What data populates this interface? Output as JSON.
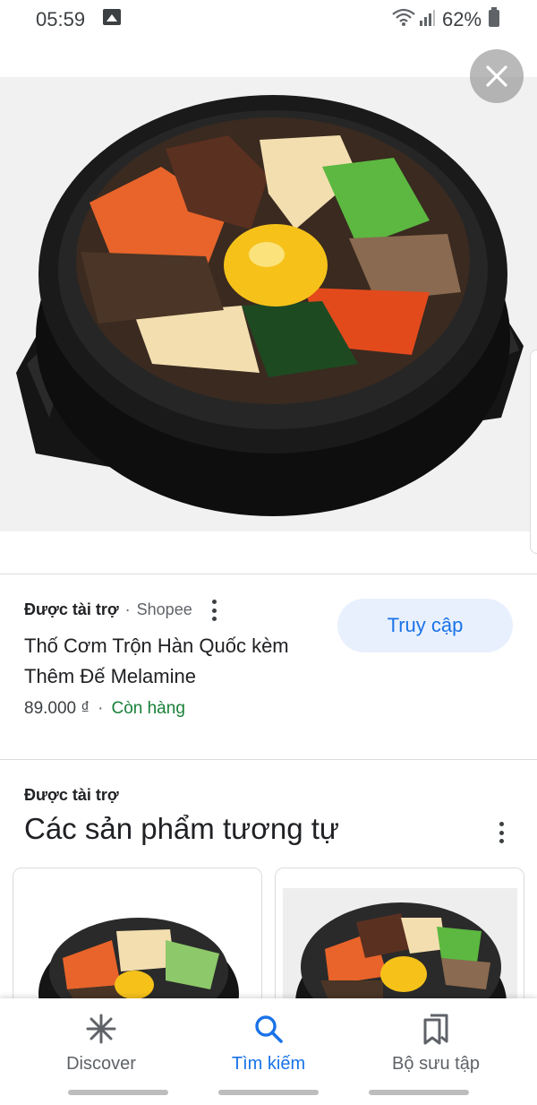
{
  "status_bar": {
    "time": "05:59",
    "battery": "62%"
  },
  "icons": {
    "gallery": "gallery-icon",
    "wifi": "wifi-icon",
    "signal": "signal-icon",
    "battery": "battery-icon",
    "close": "close-icon",
    "more": "more-vert-icon",
    "discover": "asterisk-icon",
    "search": "search-icon",
    "collections": "bookmarks-icon"
  },
  "product": {
    "sponsored_label": "Được tài trợ",
    "merchant": "Shopee",
    "separator": "·",
    "title": "Thố Cơm Trộn Hàn Quốc kèm Thêm Đế Melamine",
    "price": "89.000 ₫",
    "stock": "Còn hàng",
    "visit_label": "Truy cập"
  },
  "similar": {
    "sponsored_label": "Được tài trợ",
    "heading": "Các sản phẩm tương tự"
  },
  "bottom_nav": {
    "items": [
      {
        "label": "Discover"
      },
      {
        "label": "Tìm kiếm"
      },
      {
        "label": "Bộ sưu tập"
      }
    ],
    "active_index": 1
  },
  "colors": {
    "accent": "#1a73e8",
    "stock_green": "#188038",
    "visit_bg": "#e8f0fe"
  }
}
